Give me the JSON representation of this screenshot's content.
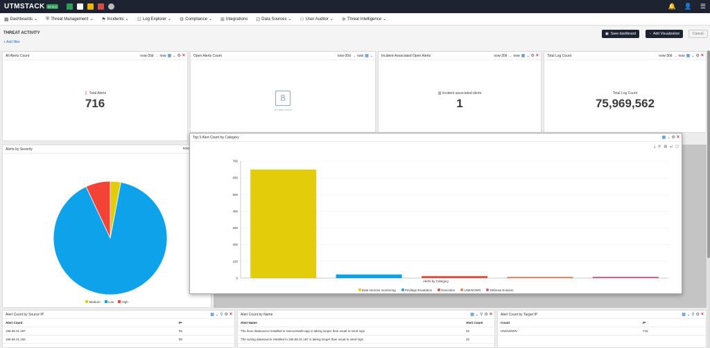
{
  "app": {
    "name": "UTMSTACK",
    "version": "10.8.2"
  },
  "menu": [
    {
      "label": "Dashboards",
      "icon": "dashboard-icon"
    },
    {
      "label": "Threat Management",
      "icon": "shield-icon"
    },
    {
      "label": "Incidents",
      "icon": "incident-icon"
    },
    {
      "label": "Log Explorer",
      "icon": "log-icon"
    },
    {
      "label": "Compliance",
      "icon": "compliance-icon"
    },
    {
      "label": "Integrations",
      "icon": "integrations-icon"
    },
    {
      "label": "Data Sources",
      "icon": "data-sources-icon"
    },
    {
      "label": "User Auditor",
      "icon": "user-auditor-icon"
    },
    {
      "label": "Threat Intelligence",
      "icon": "threat-intel-icon"
    }
  ],
  "page": {
    "title": "THREAT ACTIVITY",
    "add_filter": "+ Add filter"
  },
  "actions": {
    "save": "Save dashboard",
    "add_viz": "Add Visualization",
    "cancel": "Cancel"
  },
  "time": {
    "from": "now-30d",
    "arrow": "→",
    "to": "now"
  },
  "cards": [
    {
      "title": "All Alerts Count",
      "label": "Total Alerts",
      "value": "716"
    },
    {
      "title": "Open Alerts Count",
      "empty_value": "8",
      "empty_text": "No data found"
    },
    {
      "title": "Incident-Associated Open Alerts",
      "label": "Incident associated alerts",
      "value": "1"
    },
    {
      "title": "Total Log Count",
      "label": "Total Log Count",
      "value": "75,969,562"
    }
  ],
  "severity": {
    "title": "Alerts by Severity",
    "legend": [
      {
        "name": "Medium",
        "color": "#e3cc0a"
      },
      {
        "name": "Low",
        "color": "#0ea2ea"
      },
      {
        "name": "High",
        "color": "#f34336"
      }
    ]
  },
  "top5": {
    "title": "Top 5 Alert Count by Category",
    "xaxis": "Alerts by Category",
    "legend": [
      {
        "name": "Data sources monitoring",
        "color": "#e3cc0a"
      },
      {
        "name": "Privilege Escalation",
        "color": "#0ea2ea"
      },
      {
        "name": "Execution",
        "color": "#e74c3c"
      },
      {
        "name": "UNKNOWN",
        "color": "#f47c5c"
      },
      {
        "name": "Defense Evasion",
        "color": "#e05580"
      }
    ]
  },
  "tables": {
    "source_ip": {
      "title": "Alert Count by Source IP",
      "headers": [
        "Alert Count",
        "IP"
      ],
      "rows": [
        [
          "198.69.31.187",
          "92"
        ],
        [
          "198.69.31.184",
          "90"
        ]
      ]
    },
    "by_name": {
      "title": "Alert Count by Name",
      "headers": [
        "Alert Name",
        "Alert Count"
      ],
      "rows": [
        [
          "The linux datasource installed in insecureweb-app is taking longer than usual to send logs",
          "32"
        ],
        [
          "The syslog datasource installed in 198.69.31.187 is taking longer than usual to send logs",
          "32"
        ]
      ]
    },
    "target_ip": {
      "title": "Alert Count by Target IP",
      "headers": [
        "Count",
        "IP"
      ],
      "rows": [
        [
          "UNKNOWN",
          "716"
        ]
      ]
    }
  },
  "chart_data": [
    {
      "type": "pie",
      "title": "Alerts by Severity",
      "slices": [
        {
          "name": "Medium",
          "value": 3
        },
        {
          "name": "Low",
          "value": 90
        },
        {
          "name": "High",
          "value": 7
        }
      ]
    },
    {
      "type": "bar",
      "title": "Top 5 Alert Count by Category",
      "xlabel": "Alerts by Category",
      "categories": [
        "Data sources monitoring",
        "Privilege Escalation",
        "Execution",
        "UNKNOWN",
        "Defense Evasion"
      ],
      "values": [
        650,
        22,
        12,
        8,
        8
      ],
      "ylim": [
        0,
        700
      ],
      "yticks": [
        0,
        100,
        200,
        300,
        400,
        500,
        600,
        700
      ]
    }
  ]
}
